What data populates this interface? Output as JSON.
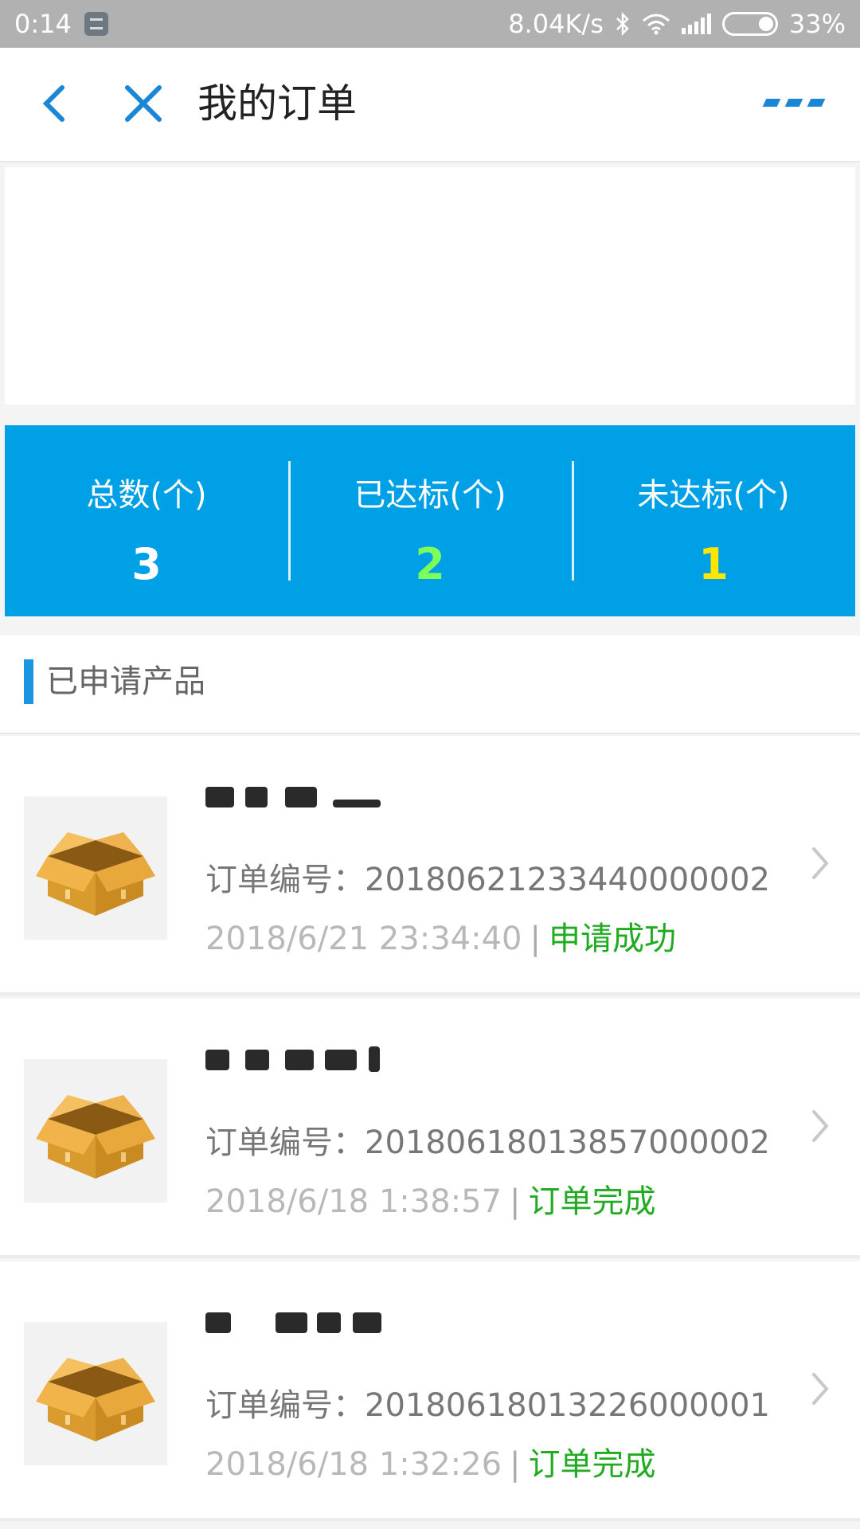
{
  "status_bar": {
    "time": "0:14",
    "speed": "8.04K/s",
    "battery": "33%"
  },
  "nav": {
    "title": "我的订单"
  },
  "stats": [
    {
      "label": "总数(个)",
      "value": "3",
      "color": "#ffffff"
    },
    {
      "label": "已达标(个)",
      "value": "2",
      "color": "#7dff5a"
    },
    {
      "label": "未达标(个)",
      "value": "1",
      "color": "#ffe600"
    }
  ],
  "section": {
    "title": "已申请产品"
  },
  "orders": [
    {
      "number": "订单编号：20180621233440000002",
      "date": "2018/6/21 23:34:40",
      "status": "申请成功"
    },
    {
      "number": "订单编号：20180618013857000002",
      "date": "2018/6/18 1:38:57",
      "status": "订单完成"
    },
    {
      "number": "订单编号：20180618013226000001",
      "date": "2018/6/18 1:32:26",
      "status": "订单完成"
    }
  ],
  "icons": {
    "back": "chevron-left-icon",
    "close": "close-icon",
    "more": "more-icon",
    "product": "box-icon",
    "row_arrow": "chevron-right-icon"
  },
  "colors": {
    "accent": "#00a0e6",
    "status_green": "#21ab21"
  }
}
